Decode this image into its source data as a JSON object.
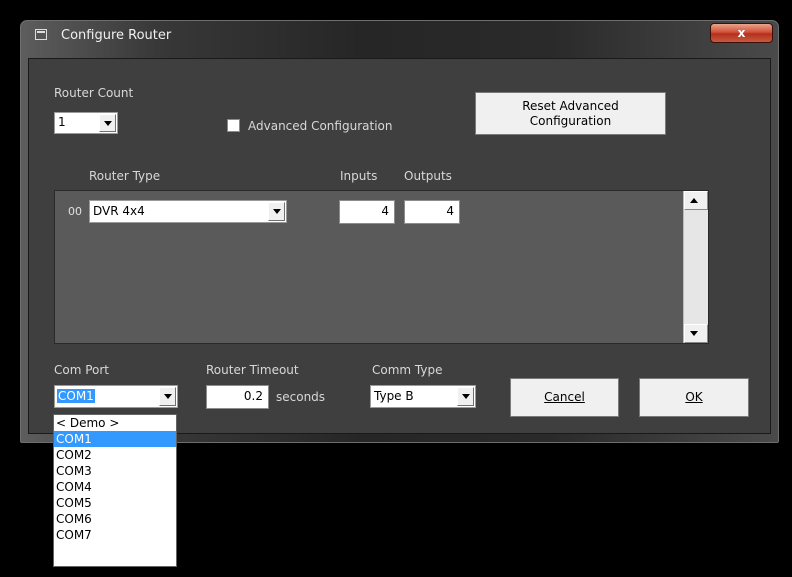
{
  "window": {
    "title": "Configure Router",
    "close_label": "x"
  },
  "router_count": {
    "label": "Router Count",
    "value": "1"
  },
  "advanced": {
    "label": "Advanced Configuration",
    "checked": false
  },
  "reset_button": {
    "line1": "Reset Advanced",
    "line2": "Configuration"
  },
  "table": {
    "col_router_type": "Router Type",
    "col_inputs": "Inputs",
    "col_outputs": "Outputs",
    "rows": [
      {
        "index": "00",
        "type": "DVR 4x4",
        "inputs": "4",
        "outputs": "4"
      }
    ]
  },
  "com_port": {
    "label": "Com Port",
    "value": "COM1",
    "options": [
      "< Demo >",
      "COM1",
      "COM2",
      "COM3",
      "COM4",
      "COM5",
      "COM6",
      "COM7"
    ],
    "highlighted": "COM1"
  },
  "router_timeout": {
    "label": "Router Timeout",
    "value": "0.2",
    "unit": "seconds"
  },
  "comm_type": {
    "label": "Comm Type",
    "value": "Type B"
  },
  "buttons": {
    "cancel": "Cancel",
    "ok": "OK"
  },
  "colors": {
    "highlight": "#3399ff",
    "client_bg": "#3f3f3f",
    "close_red": "#c4402a"
  }
}
